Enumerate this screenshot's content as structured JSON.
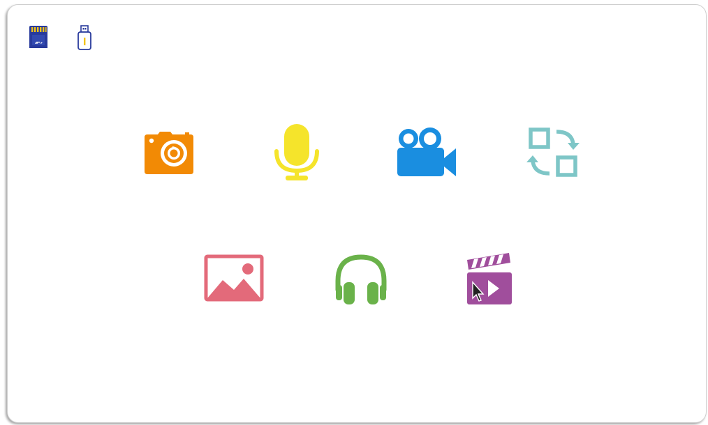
{
  "storage": [
    {
      "icon": "sd-card-icon",
      "color": "#283a9c"
    },
    {
      "icon": "usb-drive-icon",
      "color": "#283a9c",
      "accent": "#f2c318"
    }
  ],
  "apps": [
    {
      "icon": "camera-icon",
      "color": "#f28a05"
    },
    {
      "icon": "microphone-icon",
      "color": "#f5e42b"
    },
    {
      "icon": "video-camera-icon",
      "color": "#1a8ee0"
    },
    {
      "icon": "convert-icon",
      "color": "#7ec6c7"
    },
    {
      "icon": "image-gallery-icon",
      "color": "#e36a7a"
    },
    {
      "icon": "headphones-icon",
      "color": "#6ab24a"
    },
    {
      "icon": "movie-clapperboard-icon",
      "color": "#a04e9c"
    }
  ],
  "cursor": {
    "icon": "mouse-pointer-icon"
  }
}
